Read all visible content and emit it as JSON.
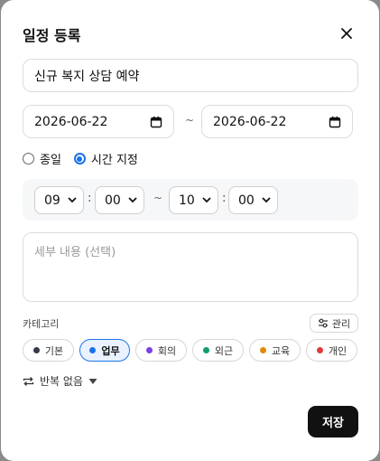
{
  "dialog": {
    "title": "일정 등록",
    "close_icon": "close-icon",
    "event_title_value": "신규 복지 상담 예약",
    "start_date": "2026-06-22",
    "end_date": "2026-06-22",
    "date_separator": "~",
    "time_mode": {
      "options": [
        {
          "label": "종일",
          "checked": false
        },
        {
          "label": "시간 지정",
          "checked": true
        }
      ]
    },
    "time": {
      "start_hour": "09",
      "start_minute": "00",
      "end_hour": "10",
      "end_minute": "00",
      "colon": ":",
      "range_separator": "~"
    },
    "details_placeholder": "세부 내용 (선택)",
    "category": {
      "label": "카테고리",
      "manage_label": "관리",
      "manage_icon": "sliders-icon",
      "items": [
        {
          "label": "기본",
          "color": "#343a4a",
          "active": false
        },
        {
          "label": "업무",
          "color": "#1a73e8",
          "active": true
        },
        {
          "label": "회의",
          "color": "#7b3fe4",
          "active": false
        },
        {
          "label": "외근",
          "color": "#0e9e6e",
          "active": false
        },
        {
          "label": "교육",
          "color": "#e08a0b",
          "active": false
        },
        {
          "label": "개인",
          "color": "#e03a3a",
          "active": false
        }
      ]
    },
    "repeat": {
      "icon": "repeat-icon",
      "label": "반복 없음"
    },
    "save_label": "저장"
  }
}
